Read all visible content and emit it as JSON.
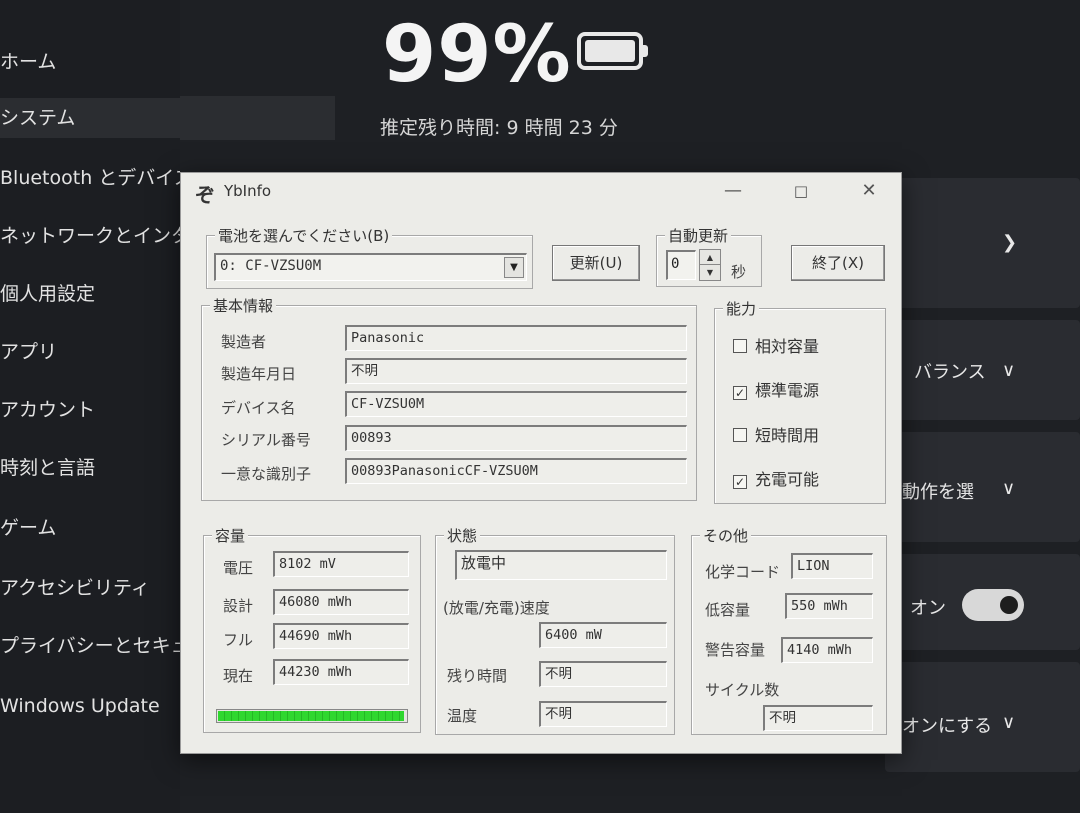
{
  "settings": {
    "sidebar": {
      "items": [
        {
          "label": "ホーム"
        },
        {
          "label": "システム"
        },
        {
          "label": "Bluetooth とデバイス"
        },
        {
          "label": "ネットワークとインターネット"
        },
        {
          "label": "個人用設定"
        },
        {
          "label": "アプリ"
        },
        {
          "label": "アカウント"
        },
        {
          "label": "時刻と言語"
        },
        {
          "label": "ゲーム"
        },
        {
          "label": "アクセシビリティ"
        },
        {
          "label": "プライバシーとセキュリティ"
        },
        {
          "label": "Windows Update"
        }
      ]
    },
    "battery": {
      "percent_text": "99%",
      "level": 0.99,
      "estimate": "推定残り時間: 9 時間 23 分"
    },
    "cards": {
      "balance_label": "バランス",
      "action_label": "動作を選",
      "toggle_label": "オン",
      "toggle_on": true,
      "turn_on_label": "オンにする"
    }
  },
  "ybinfo": {
    "title": "YbInfo",
    "battery_select": {
      "group_label": "電池を選んでください(B)",
      "value": "0: CF-VZSU0M"
    },
    "refresh_button": "更新(U)",
    "auto_update": {
      "group_label": "自動更新",
      "value": "0",
      "unit": "秒"
    },
    "exit_button": "終了(X)",
    "basic_info": {
      "group_label": "基本情報",
      "rows": [
        {
          "label": "製造者",
          "value": "Panasonic"
        },
        {
          "label": "製造年月日",
          "value": "不明"
        },
        {
          "label": "デバイス名",
          "value": "CF-VZSU0M"
        },
        {
          "label": "シリアル番号",
          "value": "00893"
        },
        {
          "label": "一意な識別子",
          "value": "00893PanasonicCF-VZSU0M"
        }
      ]
    },
    "capabilities": {
      "group_label": "能力",
      "items": [
        {
          "label": "相対容量",
          "checked": false
        },
        {
          "label": "標準電源",
          "checked": true
        },
        {
          "label": "短時間用",
          "checked": false
        },
        {
          "label": "充電可能",
          "checked": true
        }
      ]
    },
    "capacity": {
      "group_label": "容量",
      "rows": [
        {
          "label": "電圧",
          "value": "8102 mV"
        },
        {
          "label": "設計",
          "value": "46080 mWh"
        },
        {
          "label": "フル",
          "value": "44690 mWh"
        },
        {
          "label": "現在",
          "value": "44230 mWh"
        }
      ],
      "charge_level": 0.99
    },
    "status": {
      "group_label": "状態",
      "state": "放電中",
      "rate_label": "(放電/充電)速度",
      "rate_value": "6400 mW",
      "remaining_label": "残り時間",
      "remaining_value": "不明",
      "temp_label": "温度",
      "temp_value": "不明"
    },
    "other": {
      "group_label": "その他",
      "chem_label": "化学コード",
      "chem_value": "LION",
      "low_label": "低容量",
      "low_value": "550 mWh",
      "warn_label": "警告容量",
      "warn_value": "4140 mWh",
      "cycle_label": "サイクル数",
      "cycle_value": "不明"
    }
  }
}
